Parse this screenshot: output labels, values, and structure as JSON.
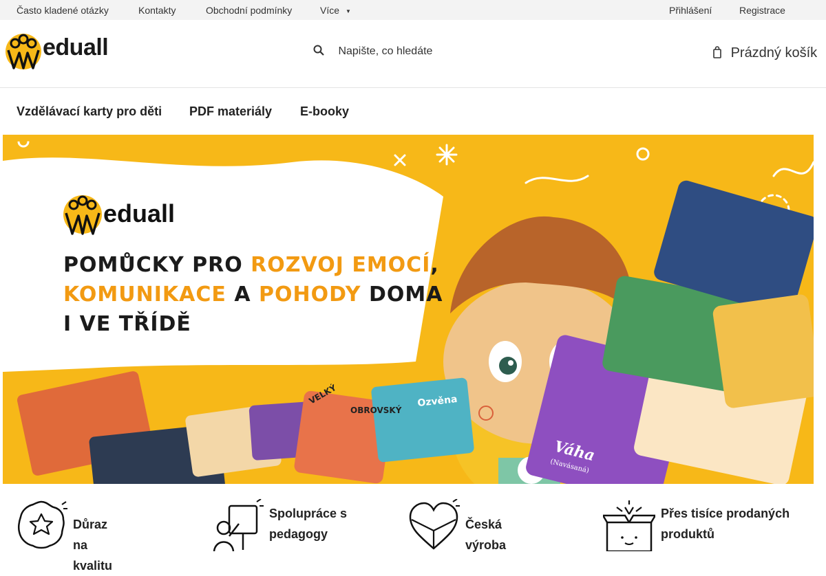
{
  "topbar": {
    "links": [
      "Často kladené otázky",
      "Kontakty",
      "Obchodní podmínky",
      "Více"
    ],
    "more_chevron": "chevron-down-icon",
    "login": "Přihlášení",
    "register": "Registrace"
  },
  "header": {
    "logo_text": "eduall",
    "search_placeholder": "Napište, co hledáte",
    "search_icon": "search-icon",
    "cart_label": "Prázdný košík",
    "cart_icon": "cart-icon"
  },
  "nav": {
    "items": [
      "Vzdělávací karty pro děti",
      "PDF materiály",
      "E-booky"
    ]
  },
  "hero": {
    "logo_text": "eduall",
    "line1_a": "POMŮCKY PRO ",
    "line1_b": "ROZVOJ EMOCÍ",
    "line1_c": ",",
    "line2_a": "KOMUNIKACE",
    "line2_b": " A ",
    "line2_c": "POHODY",
    "line2_d": " DOMA",
    "line3": "I VE TŘÍDĚ",
    "card_words": [
      "VELKÝ",
      "OBROVSKÝ",
      "Ozvěna",
      "Váha",
      "(Navásaná)"
    ],
    "colors": {
      "background": "#f7b818",
      "accent": "#f29a12"
    }
  },
  "features": [
    {
      "label": "Důraz na kvalitu",
      "icon": "quality-badge-icon"
    },
    {
      "label": "Spolupráce s pedagogy",
      "icon": "teacher-board-icon"
    },
    {
      "label": "Česká výroba",
      "icon": "heart-flag-icon"
    },
    {
      "label": "Přes tisíce prodaných produktů",
      "icon": "gift-box-icon"
    }
  ]
}
